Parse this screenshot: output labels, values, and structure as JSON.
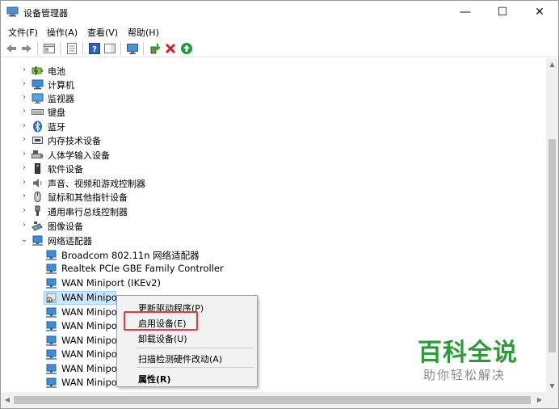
{
  "window": {
    "title": "设备管理器",
    "minimize_glyph": "—",
    "maximize_glyph": "☐",
    "close_glyph": "✕"
  },
  "menu": [
    "文件(F)",
    "操作(A)",
    "查看(V)",
    "帮助(H)"
  ],
  "tree": {
    "categories": [
      {
        "label": "电池",
        "icon": "battery-icon",
        "expanded": false
      },
      {
        "label": "计算机",
        "icon": "computer-icon",
        "expanded": false
      },
      {
        "label": "监视器",
        "icon": "monitor-icon",
        "expanded": false
      },
      {
        "label": "键盘",
        "icon": "keyboard-icon",
        "expanded": false
      },
      {
        "label": "蓝牙",
        "icon": "bluetooth-icon",
        "expanded": false
      },
      {
        "label": "内存技术设备",
        "icon": "memory-icon",
        "expanded": false
      },
      {
        "label": "人体学输入设备",
        "icon": "hid-icon",
        "expanded": false
      },
      {
        "label": "软件设备",
        "icon": "software-device-icon",
        "expanded": false
      },
      {
        "label": "声音、视频和游戏控制器",
        "icon": "speaker-icon",
        "expanded": false
      },
      {
        "label": "鼠标和其他指针设备",
        "icon": "mouse-icon",
        "expanded": false
      },
      {
        "label": "通用串行总线控制器",
        "icon": "usb-icon",
        "expanded": false
      },
      {
        "label": "图像设备",
        "icon": "camera-icon",
        "expanded": false
      },
      {
        "label": "网络适配器",
        "icon": "network-adapter-icon",
        "expanded": true
      }
    ],
    "adapters": [
      "Broadcom 802.11n 网络适配器",
      "Realtek PCIe GBE Family Controller",
      "WAN Miniport (IKEv2)",
      "WAN Minipo",
      "WAN Minipo",
      "WAN Minipo",
      "WAN Minipo",
      "WAN Minipo",
      "WAN Minipo",
      "WAN Minipo"
    ]
  },
  "context_menu": {
    "update_driver": "更新驱动程序(P)",
    "enable_device": "启用设备(E)",
    "uninstall_device": "卸载设备(U)",
    "scan_hardware": "扫描检测硬件改动(A)",
    "properties": "属性(R)"
  },
  "watermark": {
    "title": "百科全说",
    "subtitle": "助你轻松解决"
  },
  "colors": {
    "highlight_border": "#e0393e",
    "watermark_green": "#2f9a3a",
    "network_icon_blue": "#3a8fd6"
  }
}
